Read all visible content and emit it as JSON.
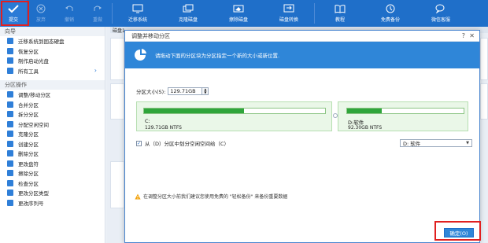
{
  "toolbar": {
    "commit": "提交",
    "discard": "放弃",
    "undo": "撤销",
    "redo": "重做",
    "migrate_os": "迁移系统",
    "clone_disk": "克隆磁盘",
    "wipe_disk": "擦除磁盘",
    "convert_disk": "磁盘转换",
    "tutorial": "教程",
    "free_backup": "免费备份",
    "wechat": "微信客服"
  },
  "sidebar": {
    "wizard_title": "向导",
    "wizard_items": [
      {
        "label": "迁移系统到固态硬盘"
      },
      {
        "label": "恢复分区"
      },
      {
        "label": "制作启动光盘"
      },
      {
        "label": "所有工具"
      }
    ],
    "ops_title": "分区操作",
    "ops_items": [
      {
        "label": "调整/移动分区"
      },
      {
        "label": "合并分区"
      },
      {
        "label": "拆分分区"
      },
      {
        "label": "分配空闲空间"
      },
      {
        "label": "克隆分区"
      },
      {
        "label": "创建分区"
      },
      {
        "label": "删除分区"
      },
      {
        "label": "更改盘符"
      },
      {
        "label": "擦除分区"
      },
      {
        "label": "检查分区"
      },
      {
        "label": "更改分区类型"
      },
      {
        "label": "更改序列号"
      }
    ]
  },
  "main": {
    "strip_label": "磁盘1"
  },
  "dialog": {
    "title": "调整并移动分区",
    "help": "?",
    "close": "✕",
    "banner_text": "请拖动下面的分区块为分区指定一个新的大小或新位置.",
    "size_label": "分区大小(S):",
    "size_value": "129.71GB",
    "left_partition": {
      "name": "C:",
      "size": "129.71GB NTFS",
      "fill": 0.55
    },
    "right_partition": {
      "name": "D:软件",
      "size": "92.30GB NTFS",
      "fill": 0.3
    },
    "option_label": "从（D）分区中划分空闲空间给（C）",
    "option_checked": "✓",
    "select_value": "D: 软件",
    "warning": "在调整分区大小前我们建议您使用免费的 \"轻松备份\" 来备份重要数据",
    "ok": "确定(O)"
  },
  "colors": {
    "toolbar": "#1f6fc9",
    "banner": "#2f86d8",
    "partition_fill": "#2fa53b",
    "highlight": "#e02020"
  }
}
